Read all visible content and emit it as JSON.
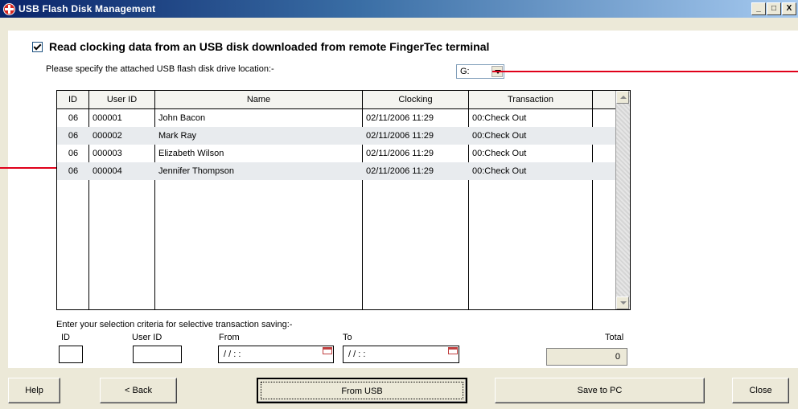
{
  "window": {
    "title": "USB Flash Disk Management",
    "controls": [
      "_",
      "□",
      "X"
    ]
  },
  "read_option": {
    "checked": true,
    "label": "Read clocking data from an USB disk downloaded from remote FingerTec terminal"
  },
  "drive": {
    "prompt": "Please specify the attached USB flash disk drive location:-",
    "selected": "G:"
  },
  "table": {
    "columns": [
      "ID",
      "User ID",
      "Name",
      "Clocking",
      "Transaction"
    ],
    "rows": [
      {
        "id": "06",
        "user_id": "000001",
        "name": "John Bacon",
        "clocking": "02/11/2006 11:29",
        "transaction": "00:Check Out"
      },
      {
        "id": "06",
        "user_id": "000002",
        "name": "Mark Ray",
        "clocking": "02/11/2006 11:29",
        "transaction": "00:Check Out"
      },
      {
        "id": "06",
        "user_id": "000003",
        "name": "Elizabeth Wilson",
        "clocking": "02/11/2006 11:29",
        "transaction": "00:Check Out"
      },
      {
        "id": "06",
        "user_id": "000004",
        "name": "Jennifer Thompson",
        "clocking": "02/11/2006 11:29",
        "transaction": "00:Check Out"
      }
    ]
  },
  "criteria": {
    "instruction": "Enter your selection criteria for selective transaction saving:-",
    "id_label": "ID",
    "user_id_label": "User ID",
    "from_label": "From",
    "from_value": "/ /   : :",
    "to_label": "To",
    "to_value": "/ /   : :",
    "total_label": "Total",
    "total_value": "0"
  },
  "buttons": {
    "help": "Help",
    "back": "< Back",
    "from_usb": "From USB",
    "save_to_pc": "Save to PC",
    "close": "Close"
  },
  "colors": {
    "title_bar": "#0a246a",
    "pointer_lines": "#e0001a",
    "alt_row": "#e8ebee"
  }
}
